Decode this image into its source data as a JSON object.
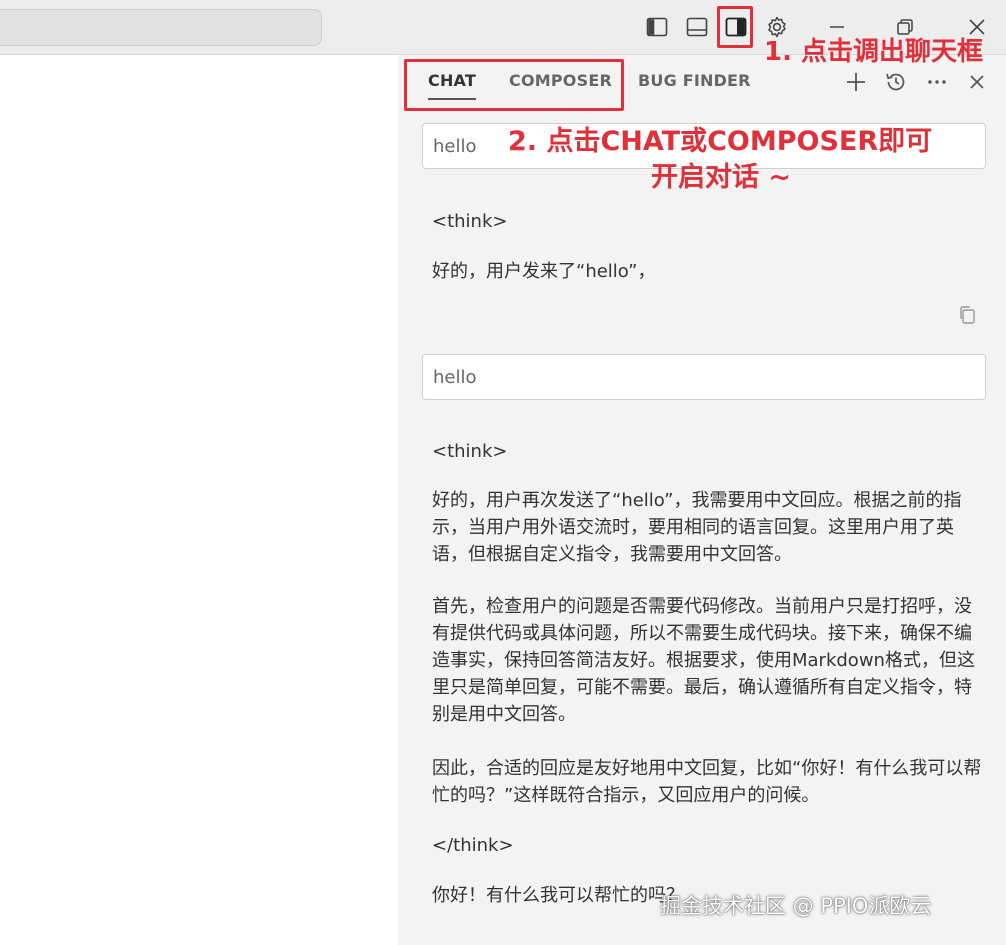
{
  "tabs": [
    {
      "label": "CHAT",
      "active": true
    },
    {
      "label": "COMPOSER",
      "active": false
    },
    {
      "label": "BUG FINDER",
      "active": false
    }
  ],
  "icons": {
    "layout_left": "layout-sidebar-left-icon",
    "layout_bottom": "layout-panel-bottom-icon",
    "layout_right": "layout-sidebar-right-icon",
    "settings": "gear-icon",
    "minimize": "minimize-icon",
    "restore": "restore-icon",
    "close": "close-icon",
    "new_chat": "plus-icon",
    "history": "history-icon",
    "more": "more-icon",
    "panel_close": "close-icon",
    "copy": "copy-icon"
  },
  "annotations": {
    "step1": "1. 点击调出聊天框",
    "step2_line1": "2. 点击CHAT或COMPOSER即可",
    "step2_line2": "开启对话 ~"
  },
  "conversation": {
    "message1": {
      "user_text": "hello",
      "think_open": "<think>",
      "reply": "好的，用户发来了“hello”，"
    },
    "message2": {
      "user_text": "hello",
      "think_open": "<think>",
      "para1": "好的，用户再次发送了“hello”，我需要用中文回应。根据之前的指示，当用户用外语交流时，要用相同的语言回复。这里用户用了英语，但根据自定义指令，我需要用中文回答。",
      "para2": "首先，检查用户的问题是否需要代码修改。当前用户只是打招呼，没有提供代码或具体问题，所以不需要生成代码块。接下来，确保不编造事实，保持回答简洁友好。根据要求，使用Markdown格式，但这里只是简单回复，可能不需要。最后，确认遵循所有自定义指令，特别是用中文回答。",
      "para3": "因此，合适的回应是友好地用中文回复，比如“你好！有什么我可以帮忙的吗？”这样既符合指示，又回应用户的问候。",
      "think_close": "</think>",
      "reply": "你好！有什么我可以帮忙的吗？"
    }
  },
  "watermark": "掘金技术社区 @ PPIO派欧云",
  "colors": {
    "accent_red": "#e0303a",
    "panel_bg": "#f3f3f3",
    "titlebar_bg": "#ededed"
  }
}
